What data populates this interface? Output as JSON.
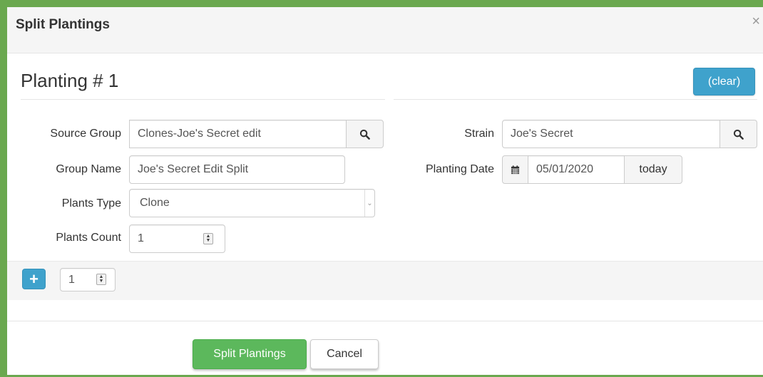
{
  "dialog": {
    "title": "Split Plantings",
    "close_glyph": "×"
  },
  "planting": {
    "heading": "Planting # 1",
    "clear_label": "(clear)",
    "source_group": {
      "label": "Source Group",
      "value": "Clones-Joe's Secret edit"
    },
    "group_name": {
      "label": "Group Name",
      "value": "Joe's Secret Edit Split"
    },
    "plants_type": {
      "label": "Plants Type",
      "value": "Clone"
    },
    "plants_count": {
      "label": "Plants Count",
      "value": "1"
    },
    "strain": {
      "label": "Strain",
      "value": "Joe's Secret"
    },
    "planting_date": {
      "label": "Planting Date",
      "value": "05/01/2020",
      "today_label": "today"
    }
  },
  "add_row": {
    "plus_glyph": "+",
    "count_value": "1"
  },
  "footer": {
    "split_label": "Split Plantings",
    "cancel_label": "Cancel"
  },
  "icons": {
    "search": "search-icon",
    "calendar": "calendar-icon",
    "close": "close-icon",
    "plus": "plus-icon"
  },
  "colors": {
    "frame_green": "#6aa84f",
    "info_blue": "#3fa2cc",
    "success_green": "#5cb85c"
  }
}
